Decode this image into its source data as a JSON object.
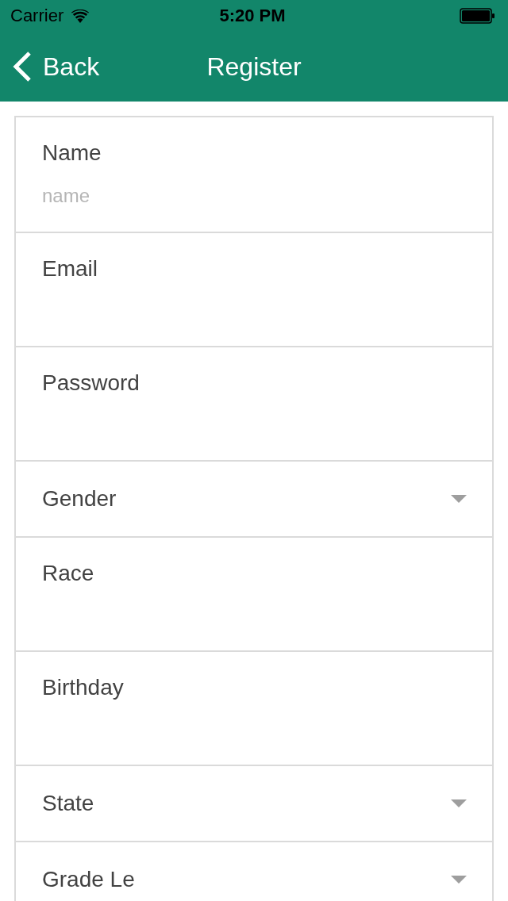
{
  "status_bar": {
    "carrier": "Carrier",
    "time": "5:20 PM"
  },
  "nav_bar": {
    "back_label": "Back",
    "title": "Register"
  },
  "form": {
    "fields": [
      {
        "kind": "text",
        "label": "Name",
        "placeholder": "name"
      },
      {
        "kind": "text",
        "label": "Email"
      },
      {
        "kind": "text",
        "label": "Password"
      },
      {
        "kind": "select",
        "label": "Gender"
      },
      {
        "kind": "text",
        "label": "Race"
      },
      {
        "kind": "text",
        "label": "Birthday"
      },
      {
        "kind": "select",
        "label": "State"
      },
      {
        "kind": "select",
        "label": "Grade Le"
      }
    ]
  }
}
